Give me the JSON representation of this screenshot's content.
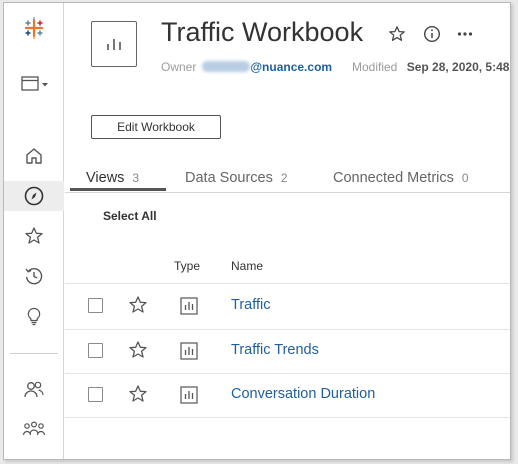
{
  "nav": {
    "items": [
      {
        "name": "tableau-logo-icon"
      },
      {
        "name": "content-menu-icon"
      },
      {
        "name": "home-icon"
      },
      {
        "name": "explore-icon"
      },
      {
        "name": "favorites-icon"
      },
      {
        "name": "recents-icon"
      },
      {
        "name": "recommendations-icon"
      },
      {
        "name": "users-icon"
      },
      {
        "name": "groups-icon"
      }
    ]
  },
  "header": {
    "title": "Traffic Workbook",
    "owner_label": "Owner",
    "owner_email_domain": "@nuance.com",
    "modified_label": "Modified",
    "modified_value": "Sep 28, 2020, 5:48",
    "edit_button": "Edit Workbook"
  },
  "tabs": [
    {
      "label": "Views",
      "count": "3"
    },
    {
      "label": "Data Sources",
      "count": "2"
    },
    {
      "label": "Connected Metrics",
      "count": "0"
    }
  ],
  "list": {
    "select_all": "Select All",
    "columns": {
      "type": "Type",
      "name": "Name"
    },
    "rows": [
      {
        "name": "Traffic"
      },
      {
        "name": "Traffic Trends"
      },
      {
        "name": "Conversation Duration"
      }
    ]
  },
  "colors": {
    "link": "#1f5f9e",
    "active_nav_bg": "#ededed"
  }
}
